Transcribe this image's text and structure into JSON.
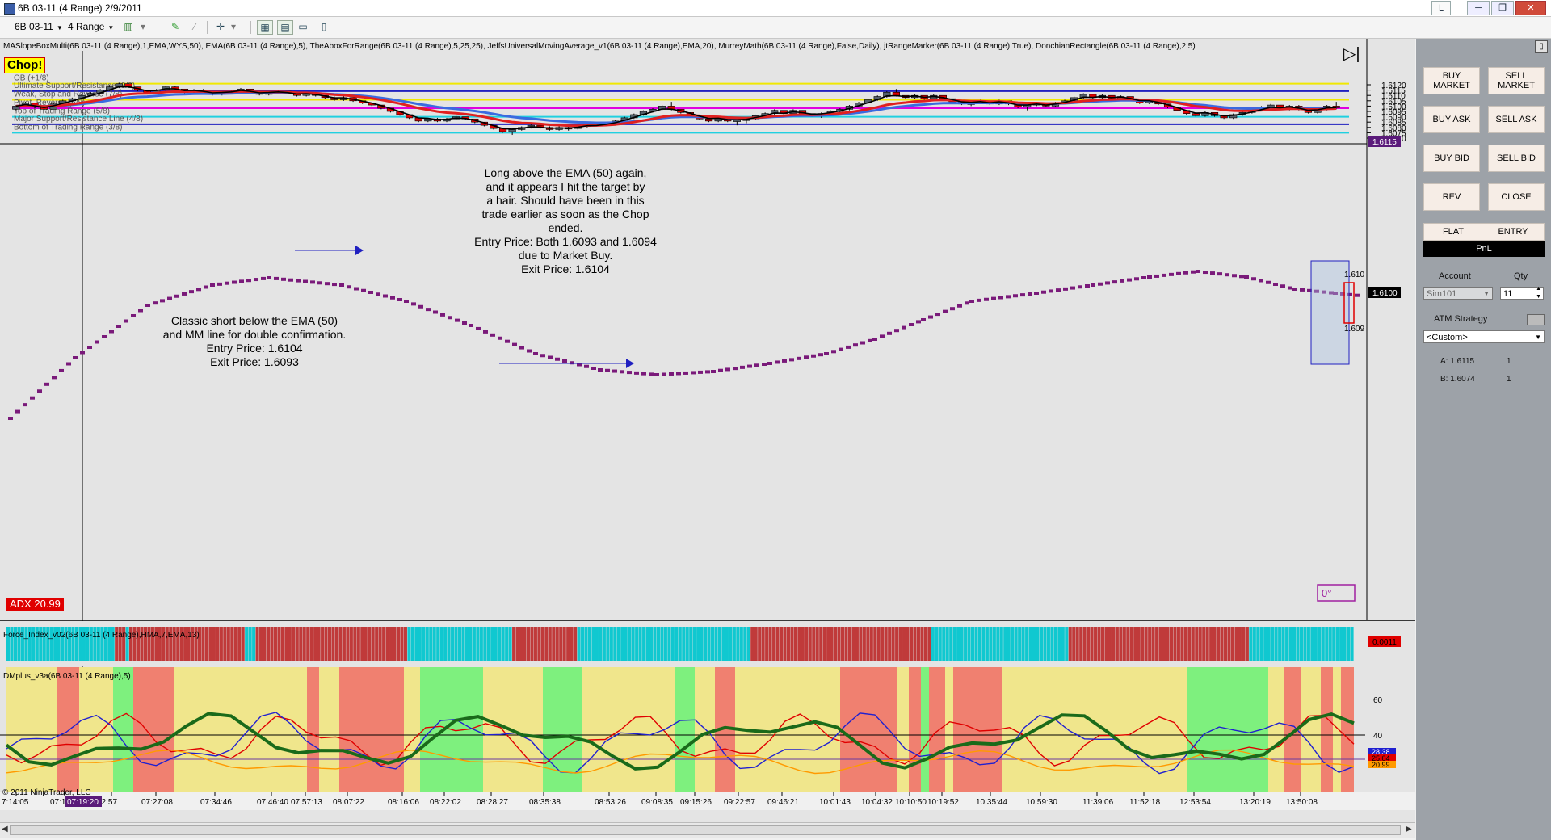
{
  "window": {
    "title": "6B 03-11 (4 Range)  2/9/2011",
    "tag_label": "L",
    "minimize": "─",
    "restore": "❐",
    "close": "✕"
  },
  "toolbar": {
    "instrument": "6B 03-11",
    "period": "4 Range",
    "icons": [
      "bar-style-icon",
      "draw-line-icon",
      "draw-tool-icon",
      "crosshair-icon",
      "indicators-icon",
      "strategies-icon",
      "properties-icon",
      "chart-trader-icon"
    ]
  },
  "chart": {
    "indicator_line": "MASlopeBoxMulti(6B 03-11 (4 Range),1,EMA,WYS,50), EMA(6B 03-11 (4 Range),5), TheAboxForRange(6B 03-11 (4 Range),5,25,25), JeffsUniversalMovingAverage_v1(6B 03-11 (4 Range),EMA,20), MurreyMath(6B 03-11 (4 Range),False,Daily), jtRangeMarker(6B 03-11 (4 Range),True), DonchianRectangle(6B 03-11 (4 Range),2,5)",
    "chop_label": "Chop!",
    "adx_label": "ADX 20.99",
    "degree_label": "0°",
    "murrey_lines": [
      {
        "label": "OB (+1/8)",
        "price": 1.6121,
        "color": "#f0e800"
      },
      {
        "label": "Ultimate Support/Resistance (8/8)",
        "price": 1.6114,
        "color": "#2020c0"
      },
      {
        "label": "Weak, Stop and Reverse (7/8)",
        "price": 1.6106,
        "color": "#f0e800"
      },
      {
        "label": "Pivot, Reverse (6/8)",
        "price": 1.6098,
        "color": "#e000e0"
      },
      {
        "label": "Top of Trading Range (5/8)",
        "price": 1.609,
        "color": "#20d0e0"
      },
      {
        "label": "Major Support/Resistance Line (4/8)",
        "price": 1.6083,
        "color": "#2020c0"
      },
      {
        "label": "Bottom of Trading Range (3/8)",
        "price": 1.6075,
        "color": "#20d0e0"
      }
    ],
    "price_ticks": [
      "1.6120",
      "1.6115",
      "1.6110",
      "1.6105",
      "1.6100",
      "1.6095",
      "1.6090",
      "1.6085",
      "1.6080",
      "1.6075",
      "1.6070"
    ],
    "price_markers": {
      "upper": "1.6115",
      "current": "1.6100"
    },
    "annotation_long": [
      "Long above the EMA (50) again,",
      "and it appears I hit the target by",
      "a hair.  Should have been in this",
      "trade earlier as soon as the Chop",
      "ended.",
      "Entry Price: Both 1.6093 and 1.6094",
      "due to Market Buy.",
      "Exit Price: 1.6104"
    ],
    "annotation_short": [
      "Classic short below the EMA (50)",
      "and MM line for double confirmation.",
      "Entry Price: 1.6104",
      "Exit Price: 1.6093"
    ],
    "clipped_labels": [
      "1.610",
      "1.609"
    ]
  },
  "force_index": {
    "label": "Force_Index_v02(6B 03-11 (4 Range),HMA,7,EMA,13)",
    "value": "0.0011"
  },
  "dmplus": {
    "label": "DMplus_v3a(6B 03-11 (4 Range),5)",
    "ticks": [
      "60",
      "40"
    ],
    "values": [
      "28.38",
      "25.04",
      "20.99"
    ]
  },
  "time_axis": {
    "ticks": [
      "7:14:05",
      "07:18",
      "22:57",
      "07:27:08",
      "07:34:46",
      "07:46:40",
      "07:57:13",
      "08:07:22",
      "08:16:06",
      "08:22:02",
      "08:28:27",
      "08:35:38",
      "08:53:26",
      "09:08:35",
      "09:15:26",
      "09:22:57",
      "09:46:21",
      "10:01:43",
      "10:04:32",
      "10:10:50",
      "10:19:52",
      "10:35:44",
      "10:59:30",
      "11:39:06",
      "11:52:18",
      "12:53:54",
      "13:20:19",
      "13:50:08"
    ],
    "cursor_time": "07:19:20"
  },
  "copyright": "© 2011 NinjaTrader, LLC",
  "chart_trader": {
    "buy_market": "BUY MARKET",
    "sell_market": "SELL MARKET",
    "buy_ask": "BUY ASK",
    "sell_ask": "SELL ASK",
    "buy_bid": "BUY BID",
    "sell_bid": "SELL BID",
    "rev": "REV",
    "close": "CLOSE",
    "flat": "FLAT",
    "entry": "ENTRY",
    "pnl": "PnL",
    "account_label": "Account",
    "qty_label": "Qty",
    "account": "Sim101",
    "qty": "11",
    "atm_label": "ATM Strategy",
    "atm_value": "<Custom>",
    "ask_label": "A: 1.6115",
    "ask_qty": "1",
    "bid_label": "B: 1.6074",
    "bid_qty": "1"
  },
  "colors": {
    "background": "#e4e4e4",
    "panel": "#9da2a8",
    "up_candle": "#55606b",
    "down_candle": "#e00000"
  }
}
